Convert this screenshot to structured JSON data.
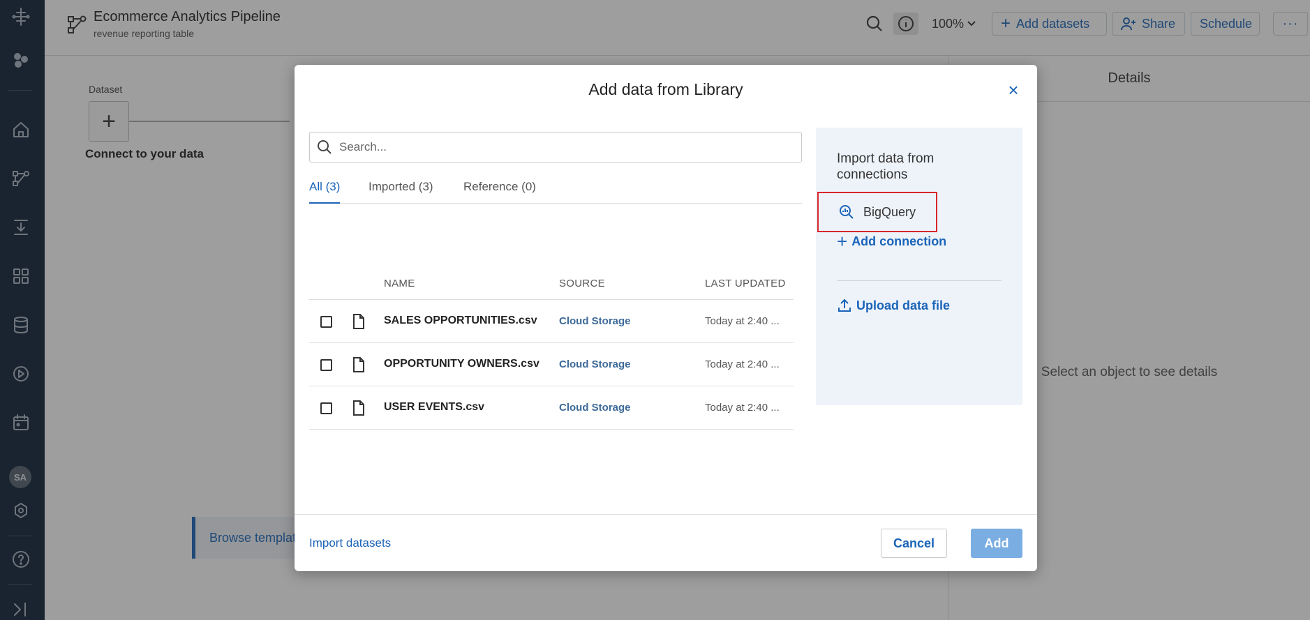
{
  "header": {
    "title": "Ecommerce Analytics Pipeline",
    "subtitle": "revenue reporting table",
    "zoom": "100%",
    "add_datasets": "Add datasets",
    "share": "Share",
    "schedule": "Schedule"
  },
  "sidebar": {
    "avatar_initials": "SA",
    "icons": [
      "logo-icon",
      "ai-icon",
      "home-icon",
      "flows-icon",
      "import-icon",
      "apps-icon",
      "database-icon",
      "jobs-icon",
      "schedule-icon",
      "settings-icon",
      "help-icon",
      "collapse-icon"
    ]
  },
  "canvas": {
    "dataset_label": "Dataset",
    "plus": "+",
    "connect_text": "Connect to your data",
    "browse_text": "Browse templat"
  },
  "details": {
    "title": "Details",
    "empty_text": "Select an object to see details"
  },
  "modal": {
    "title": "Add data from Library",
    "close": "×",
    "search_placeholder": "Search...",
    "tabs": [
      {
        "label": "All (3)",
        "active": true
      },
      {
        "label": "Imported (3)",
        "active": false
      },
      {
        "label": "Reference (0)",
        "active": false
      }
    ],
    "columns": {
      "name": "NAME",
      "source": "SOURCE",
      "last_updated": "LAST UPDATED"
    },
    "rows": [
      {
        "name": "SALES OPPORTUNITIES.csv",
        "source": "Cloud Storage",
        "updated": "Today at 2:40 ..."
      },
      {
        "name": "OPPORTUNITY OWNERS.csv",
        "source": "Cloud Storage",
        "updated": "Today at 2:40 ..."
      },
      {
        "name": "USER EVENTS.csv",
        "source": "Cloud Storage",
        "updated": "Today at 2:40 ..."
      }
    ],
    "right_panel": {
      "title": "Import data from connections",
      "bigquery": "BigQuery",
      "add_connection": "Add connection",
      "upload_file": "Upload data file"
    },
    "footer": {
      "import_datasets": "Import datasets",
      "cancel": "Cancel",
      "add": "Add"
    }
  },
  "colors": {
    "accent": "#1b64b8",
    "rail": "#0f2137",
    "highlight": "#d9262c",
    "add_button": "#7aaee2"
  }
}
